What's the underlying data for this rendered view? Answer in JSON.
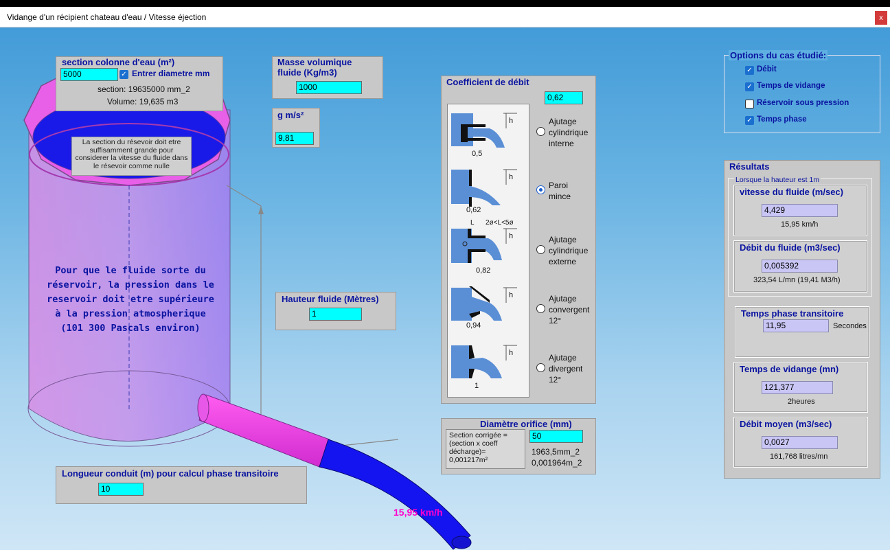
{
  "window": {
    "title": "Vidange d'un récipient chateau d'eau  / Vitesse éjection",
    "close": "x"
  },
  "section": {
    "heading": "section colonne d'eau (m²)",
    "value": "5000",
    "checkbox_label": "Entrer diametre mm",
    "section_text": "section: 19635000 mm_2",
    "volume_text": "Volume: 19,635 m3"
  },
  "note": {
    "text": "La section du résevoir doit etre suffisamment grande pour considerer la vitesse du fluide dans le résevoir comme nulle"
  },
  "tank_text": {
    "l1": "Pour que le fluide sorte du",
    "l2": "réservoir, la pression dans le",
    "l3": "reservoir doit etre supérieure",
    "l4": "à la pression atmospherique",
    "l5": "(101 300 Pascals environ)"
  },
  "masse": {
    "heading_l1": "Masse volumique",
    "heading_l2": "fluide  (Kg/m3)",
    "value": "1000"
  },
  "gravity": {
    "heading": "g m/s²",
    "value": "9,81"
  },
  "hauteur": {
    "heading": "Hauteur fluide (Mètres)",
    "value": "1"
  },
  "longueur": {
    "heading": "Longueur conduit (m) pour calcul phase transitoire",
    "value": "10"
  },
  "speed_label": "15,95 km/h",
  "coef": {
    "heading": "Coefficient de débit",
    "value": "0,62",
    "options": [
      {
        "l1": "Ajutage",
        "l2": "cylindrique",
        "l3": "interne",
        "coef": "0,5"
      },
      {
        "l1": "Paroi",
        "l2": "mince",
        "l3": "",
        "coef": "0,62"
      },
      {
        "l1": "Ajutage",
        "l2": "cylindrique",
        "l3": "externe",
        "coef": "0,82"
      },
      {
        "l1": "Ajutage",
        "l2": "convergent",
        "l3": "12°",
        "coef": "0,94"
      },
      {
        "l1": "Ajutage",
        "l2": "divergent",
        "l3": "12°",
        "coef": "1"
      }
    ],
    "selected_index": 1,
    "h_label": "h",
    "l_label": "L",
    "dim_label": "2ø<L<5ø"
  },
  "diametre": {
    "heading": "Diamètre orifice (mm)",
    "value": "50",
    "corrigee_l1": "Section corrigée =",
    "corrigee_l2": "(section x coeff",
    "corrigee_l3": "décharge)=",
    "corrigee_l4": "0,001217m²",
    "mm2": "1963,5mm_2",
    "m2": "0,001964m_2"
  },
  "options": {
    "heading": "Options du cas étudié:",
    "items": [
      {
        "label": "Débit",
        "checked": true
      },
      {
        "label": "Temps de vidange",
        "checked": true
      },
      {
        "label": "Réservoir sous pression",
        "checked": false
      },
      {
        "label": "Temps phase",
        "checked": true
      }
    ]
  },
  "resultats": {
    "heading": "Résultats",
    "sub": "Lorsque la hauteur est  1m",
    "vitesse": {
      "heading": "vitesse du fluide (m/sec)",
      "value": "4,429",
      "sub": "15,95 km/h"
    },
    "debit": {
      "heading": "Débit du fluide (m3/sec)",
      "value": "0,005392",
      "sub": "323,54 L/mn (19,41 M3/h)"
    },
    "transitoire": {
      "heading": "Temps phase transitoire",
      "value": "11,95",
      "unit": "Secondes"
    },
    "vidange": {
      "heading": "Temps de vidange (mn)",
      "value": "121,377",
      "sub": "2heures"
    },
    "moyen": {
      "heading": "Débit moyen (m3/sec)",
      "value": "0,0027",
      "sub": "161,768 litres/mn"
    }
  },
  "colors": {
    "accent": "#0a14a0",
    "input": "#00ffff",
    "result_input": "#c9c6f5",
    "tank": "#d58be0",
    "pipe": "#1414f0",
    "speed": "#ff00cc"
  }
}
